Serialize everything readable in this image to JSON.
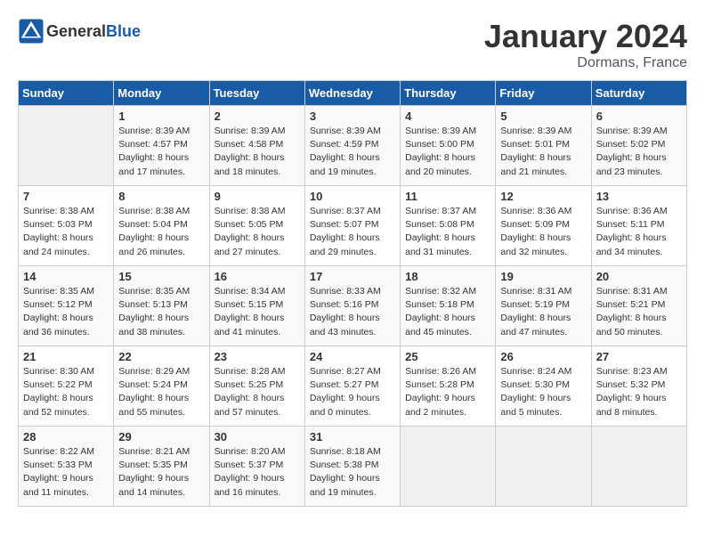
{
  "header": {
    "logo_general": "General",
    "logo_blue": "Blue",
    "month": "January 2024",
    "location": "Dormans, France"
  },
  "weekdays": [
    "Sunday",
    "Monday",
    "Tuesday",
    "Wednesday",
    "Thursday",
    "Friday",
    "Saturday"
  ],
  "weeks": [
    [
      {
        "day": "",
        "info": ""
      },
      {
        "day": "1",
        "info": "Sunrise: 8:39 AM\nSunset: 4:57 PM\nDaylight: 8 hours\nand 17 minutes."
      },
      {
        "day": "2",
        "info": "Sunrise: 8:39 AM\nSunset: 4:58 PM\nDaylight: 8 hours\nand 18 minutes."
      },
      {
        "day": "3",
        "info": "Sunrise: 8:39 AM\nSunset: 4:59 PM\nDaylight: 8 hours\nand 19 minutes."
      },
      {
        "day": "4",
        "info": "Sunrise: 8:39 AM\nSunset: 5:00 PM\nDaylight: 8 hours\nand 20 minutes."
      },
      {
        "day": "5",
        "info": "Sunrise: 8:39 AM\nSunset: 5:01 PM\nDaylight: 8 hours\nand 21 minutes."
      },
      {
        "day": "6",
        "info": "Sunrise: 8:39 AM\nSunset: 5:02 PM\nDaylight: 8 hours\nand 23 minutes."
      }
    ],
    [
      {
        "day": "7",
        "info": "Sunrise: 8:38 AM\nSunset: 5:03 PM\nDaylight: 8 hours\nand 24 minutes."
      },
      {
        "day": "8",
        "info": "Sunrise: 8:38 AM\nSunset: 5:04 PM\nDaylight: 8 hours\nand 26 minutes."
      },
      {
        "day": "9",
        "info": "Sunrise: 8:38 AM\nSunset: 5:05 PM\nDaylight: 8 hours\nand 27 minutes."
      },
      {
        "day": "10",
        "info": "Sunrise: 8:37 AM\nSunset: 5:07 PM\nDaylight: 8 hours\nand 29 minutes."
      },
      {
        "day": "11",
        "info": "Sunrise: 8:37 AM\nSunset: 5:08 PM\nDaylight: 8 hours\nand 31 minutes."
      },
      {
        "day": "12",
        "info": "Sunrise: 8:36 AM\nSunset: 5:09 PM\nDaylight: 8 hours\nand 32 minutes."
      },
      {
        "day": "13",
        "info": "Sunrise: 8:36 AM\nSunset: 5:11 PM\nDaylight: 8 hours\nand 34 minutes."
      }
    ],
    [
      {
        "day": "14",
        "info": "Sunrise: 8:35 AM\nSunset: 5:12 PM\nDaylight: 8 hours\nand 36 minutes."
      },
      {
        "day": "15",
        "info": "Sunrise: 8:35 AM\nSunset: 5:13 PM\nDaylight: 8 hours\nand 38 minutes."
      },
      {
        "day": "16",
        "info": "Sunrise: 8:34 AM\nSunset: 5:15 PM\nDaylight: 8 hours\nand 41 minutes."
      },
      {
        "day": "17",
        "info": "Sunrise: 8:33 AM\nSunset: 5:16 PM\nDaylight: 8 hours\nand 43 minutes."
      },
      {
        "day": "18",
        "info": "Sunrise: 8:32 AM\nSunset: 5:18 PM\nDaylight: 8 hours\nand 45 minutes."
      },
      {
        "day": "19",
        "info": "Sunrise: 8:31 AM\nSunset: 5:19 PM\nDaylight: 8 hours\nand 47 minutes."
      },
      {
        "day": "20",
        "info": "Sunrise: 8:31 AM\nSunset: 5:21 PM\nDaylight: 8 hours\nand 50 minutes."
      }
    ],
    [
      {
        "day": "21",
        "info": "Sunrise: 8:30 AM\nSunset: 5:22 PM\nDaylight: 8 hours\nand 52 minutes."
      },
      {
        "day": "22",
        "info": "Sunrise: 8:29 AM\nSunset: 5:24 PM\nDaylight: 8 hours\nand 55 minutes."
      },
      {
        "day": "23",
        "info": "Sunrise: 8:28 AM\nSunset: 5:25 PM\nDaylight: 8 hours\nand 57 minutes."
      },
      {
        "day": "24",
        "info": "Sunrise: 8:27 AM\nSunset: 5:27 PM\nDaylight: 9 hours\nand 0 minutes."
      },
      {
        "day": "25",
        "info": "Sunrise: 8:26 AM\nSunset: 5:28 PM\nDaylight: 9 hours\nand 2 minutes."
      },
      {
        "day": "26",
        "info": "Sunrise: 8:24 AM\nSunset: 5:30 PM\nDaylight: 9 hours\nand 5 minutes."
      },
      {
        "day": "27",
        "info": "Sunrise: 8:23 AM\nSunset: 5:32 PM\nDaylight: 9 hours\nand 8 minutes."
      }
    ],
    [
      {
        "day": "28",
        "info": "Sunrise: 8:22 AM\nSunset: 5:33 PM\nDaylight: 9 hours\nand 11 minutes."
      },
      {
        "day": "29",
        "info": "Sunrise: 8:21 AM\nSunset: 5:35 PM\nDaylight: 9 hours\nand 14 minutes."
      },
      {
        "day": "30",
        "info": "Sunrise: 8:20 AM\nSunset: 5:37 PM\nDaylight: 9 hours\nand 16 minutes."
      },
      {
        "day": "31",
        "info": "Sunrise: 8:18 AM\nSunset: 5:38 PM\nDaylight: 9 hours\nand 19 minutes."
      },
      {
        "day": "",
        "info": ""
      },
      {
        "day": "",
        "info": ""
      },
      {
        "day": "",
        "info": ""
      }
    ]
  ]
}
